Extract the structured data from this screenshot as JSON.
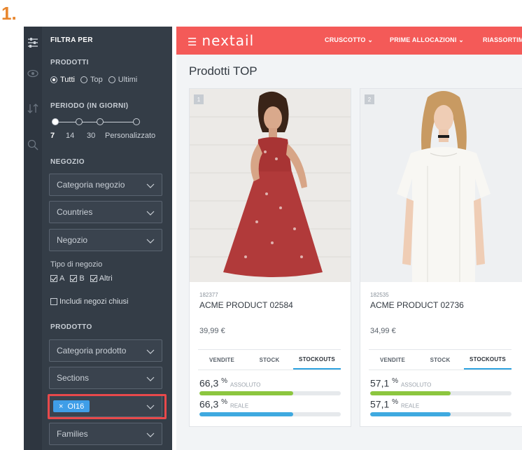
{
  "step_label": "1.",
  "colors": {
    "accent": "#f45a58",
    "panel": "#343d47",
    "tag": "#3f9ee8",
    "highlight": "#e8494b",
    "bar_green": "#8cc63f",
    "bar_blue": "#3fa9e0",
    "tab_active": "#2fa3e0"
  },
  "rail_icons": [
    "sliders-icon",
    "eye-icon",
    "sort-icon",
    "search-icon"
  ],
  "filter": {
    "header": "FILTRA PER",
    "products_label": "PRODOTTI",
    "product_options": [
      {
        "label": "Tutti",
        "selected": true
      },
      {
        "label": "Top",
        "selected": false
      },
      {
        "label": "Ultimi",
        "selected": false
      }
    ],
    "period_label": "PERIODO (IN GIORNI)",
    "period_ticks": [
      "7",
      "14",
      "30",
      "Personalizzato"
    ],
    "period_selected": "7",
    "store_label": "NEGOZIO",
    "store_category": "Categoria negozio",
    "countries": "Countries",
    "store": "Negozio",
    "store_type_label": "Tipo di negozio",
    "store_types": [
      {
        "label": "A",
        "checked": true
      },
      {
        "label": "B",
        "checked": true
      },
      {
        "label": "Altri",
        "checked": true
      }
    ],
    "include_closed": "Includi negozi chiusi",
    "include_closed_checked": false,
    "product_label": "PRODOTTO",
    "product_category": "Categoria prodotto",
    "sections": "Sections",
    "season_tag": "OI16",
    "families": "Families"
  },
  "topbar": {
    "logo": "nextail",
    "nav": [
      "CRUSCOTTO",
      "PRIME ALLOCAZIONI",
      "RIASSORTIM"
    ]
  },
  "page_title": "Prodotti TOP",
  "cards": [
    {
      "rank": "1",
      "code": "182377",
      "name": "ACME PRODUCT 02584",
      "price": "39,99 €",
      "tabs": [
        "VENDITE",
        "STOCK",
        "STOCKOUTS"
      ],
      "active_tab": "STOCKOUTS",
      "absolute_value": "66,3",
      "absolute_unit": "%",
      "absolute_label": "ASSOLUTO",
      "absolute_fraction": 0.663,
      "real_value": "66,3",
      "real_unit": "%",
      "real_label": "REALE",
      "real_fraction": 0.663
    },
    {
      "rank": "2",
      "code": "182535",
      "name": "ACME PRODUCT 02736",
      "price": "34,99 €",
      "tabs": [
        "VENDITE",
        "STOCK",
        "STOCKOUTS"
      ],
      "active_tab": "STOCKOUTS",
      "absolute_value": "57,1",
      "absolute_unit": "%",
      "absolute_label": "ASSOLUTO",
      "absolute_fraction": 0.571,
      "real_value": "57,1",
      "real_unit": "%",
      "real_label": "REALE",
      "real_fraction": 0.571
    }
  ]
}
